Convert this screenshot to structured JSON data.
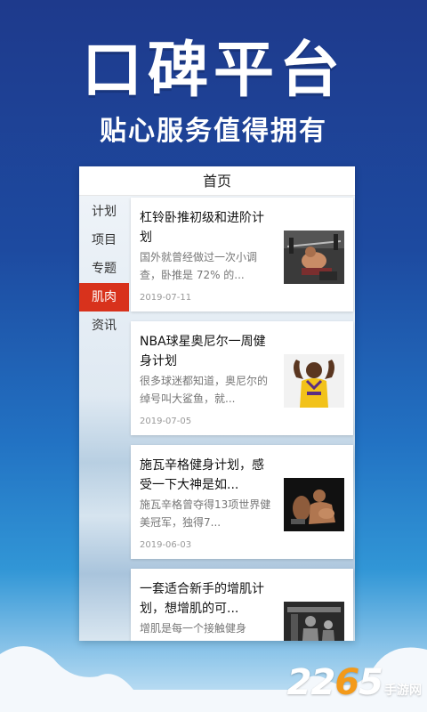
{
  "hero": {
    "title": "口碑平台",
    "subtitle": "贴心服务值得拥有"
  },
  "app": {
    "header_title": "首页",
    "sidebar": [
      {
        "label": "计划",
        "active": false
      },
      {
        "label": "项目",
        "active": false
      },
      {
        "label": "专题",
        "active": false
      },
      {
        "label": "肌肉",
        "active": true
      },
      {
        "label": "资讯",
        "active": false
      }
    ],
    "articles": [
      {
        "title": "杠铃卧推初级和进阶计划",
        "summary": "国外就曾经做过一次小调查，卧推是 72% 的...",
        "date": "2019-07-11",
        "thumb": "bench-press-photo"
      },
      {
        "title": "NBA球星奥尼尔一周健身计划",
        "summary": "很多球迷都知道，奥尼尔的绰号叫大鲨鱼，就...",
        "date": "2019-07-05",
        "thumb": "basketball-player-photo"
      },
      {
        "title": "施瓦辛格健身计划，感受一下大神是如...",
        "summary": "施瓦辛格曾夺得13项世界健美冠军，独得7...",
        "date": "2019-06-03",
        "thumb": "bodybuilder-photo"
      },
      {
        "title": "一套适合新手的增肌计划，想增肌的可...",
        "summary": "增肌是每一个接触健身",
        "date": "",
        "thumb": "gym-photo"
      }
    ]
  },
  "watermark": {
    "num_a": "22",
    "num_b": "6",
    "num_c": "5",
    "text": "手游网"
  }
}
